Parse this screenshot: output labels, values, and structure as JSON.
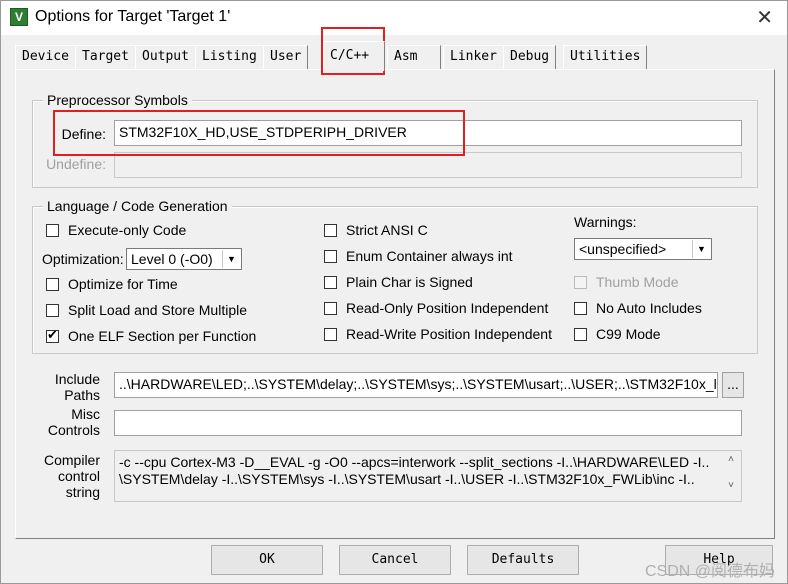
{
  "window": {
    "title": "Options for Target 'Target 1'",
    "icon_text": "V",
    "close_glyph": "✕"
  },
  "tabs": [
    {
      "label": "Device"
    },
    {
      "label": "Target"
    },
    {
      "label": "Output"
    },
    {
      "label": "Listing"
    },
    {
      "label": "User"
    },
    {
      "label": "C/C++"
    },
    {
      "label": "Asm"
    },
    {
      "label": "Linker"
    },
    {
      "label": "Debug"
    },
    {
      "label": "Utilities"
    }
  ],
  "preprocessor": {
    "title": "Preprocessor Symbols",
    "define_label": "Define:",
    "define_value": "STM32F10X_HD,USE_STDPERIPH_DRIVER",
    "undefine_label": "Undefine:",
    "undefine_value": ""
  },
  "language": {
    "title": "Language / Code Generation",
    "execute_only": {
      "label": "Execute-only Code",
      "checked": false
    },
    "optimization_label": "Optimization:",
    "optimization_value": "Level 0 (-O0)",
    "optimize_time": {
      "label": "Optimize for Time",
      "checked": false
    },
    "split_load": {
      "label": "Split Load and Store Multiple",
      "checked": false
    },
    "one_elf": {
      "label": "One ELF Section per Function",
      "checked": true,
      "tick": "✔"
    },
    "strict_ansi": {
      "label": "Strict ANSI C",
      "checked": false
    },
    "enum_container": {
      "label": "Enum Container always int",
      "checked": false
    },
    "plain_char": {
      "label": "Plain Char is Signed",
      "checked": false
    },
    "ro_position": {
      "label": "Read-Only Position Independent",
      "checked": false
    },
    "rw_position": {
      "label": "Read-Write Position Independent",
      "checked": false
    },
    "warnings_label": "Warnings:",
    "warnings_value": "<unspecified>",
    "thumb_mode": {
      "label": "Thumb Mode",
      "checked": false
    },
    "no_auto_includes": {
      "label": "No Auto Includes",
      "checked": false
    },
    "c99_mode": {
      "label": "C99 Mode",
      "checked": false
    }
  },
  "include_paths": {
    "label_line1": "Include",
    "label_line2": "Paths",
    "value": "..\\HARDWARE\\LED;..\\SYSTEM\\delay;..\\SYSTEM\\sys;..\\SYSTEM\\usart;..\\USER;..\\STM32F10x_l",
    "browse_label": "..."
  },
  "misc_controls": {
    "label_line1": "Misc",
    "label_line2": "Controls",
    "value": ""
  },
  "compiler_string": {
    "label_line1": "Compiler",
    "label_line2": "control",
    "label_line3": "string",
    "line1": "-c --cpu Cortex-M3 -D__EVAL -g -O0 --apcs=interwork --split_sections -I..\\HARDWARE\\LED -I..",
    "line2": "\\SYSTEM\\delay -I..\\SYSTEM\\sys -I..\\SYSTEM\\usart -I..\\USER -I..\\STM32F10x_FWLib\\inc -I..",
    "scroll_up": "˄",
    "scroll_down": "˅"
  },
  "buttons": {
    "ok": "OK",
    "cancel": "Cancel",
    "defaults": "Defaults",
    "help": "Help"
  },
  "watermark": "CSDN @阅德布妈",
  "colors": {
    "highlight_red": "#e02020"
  }
}
